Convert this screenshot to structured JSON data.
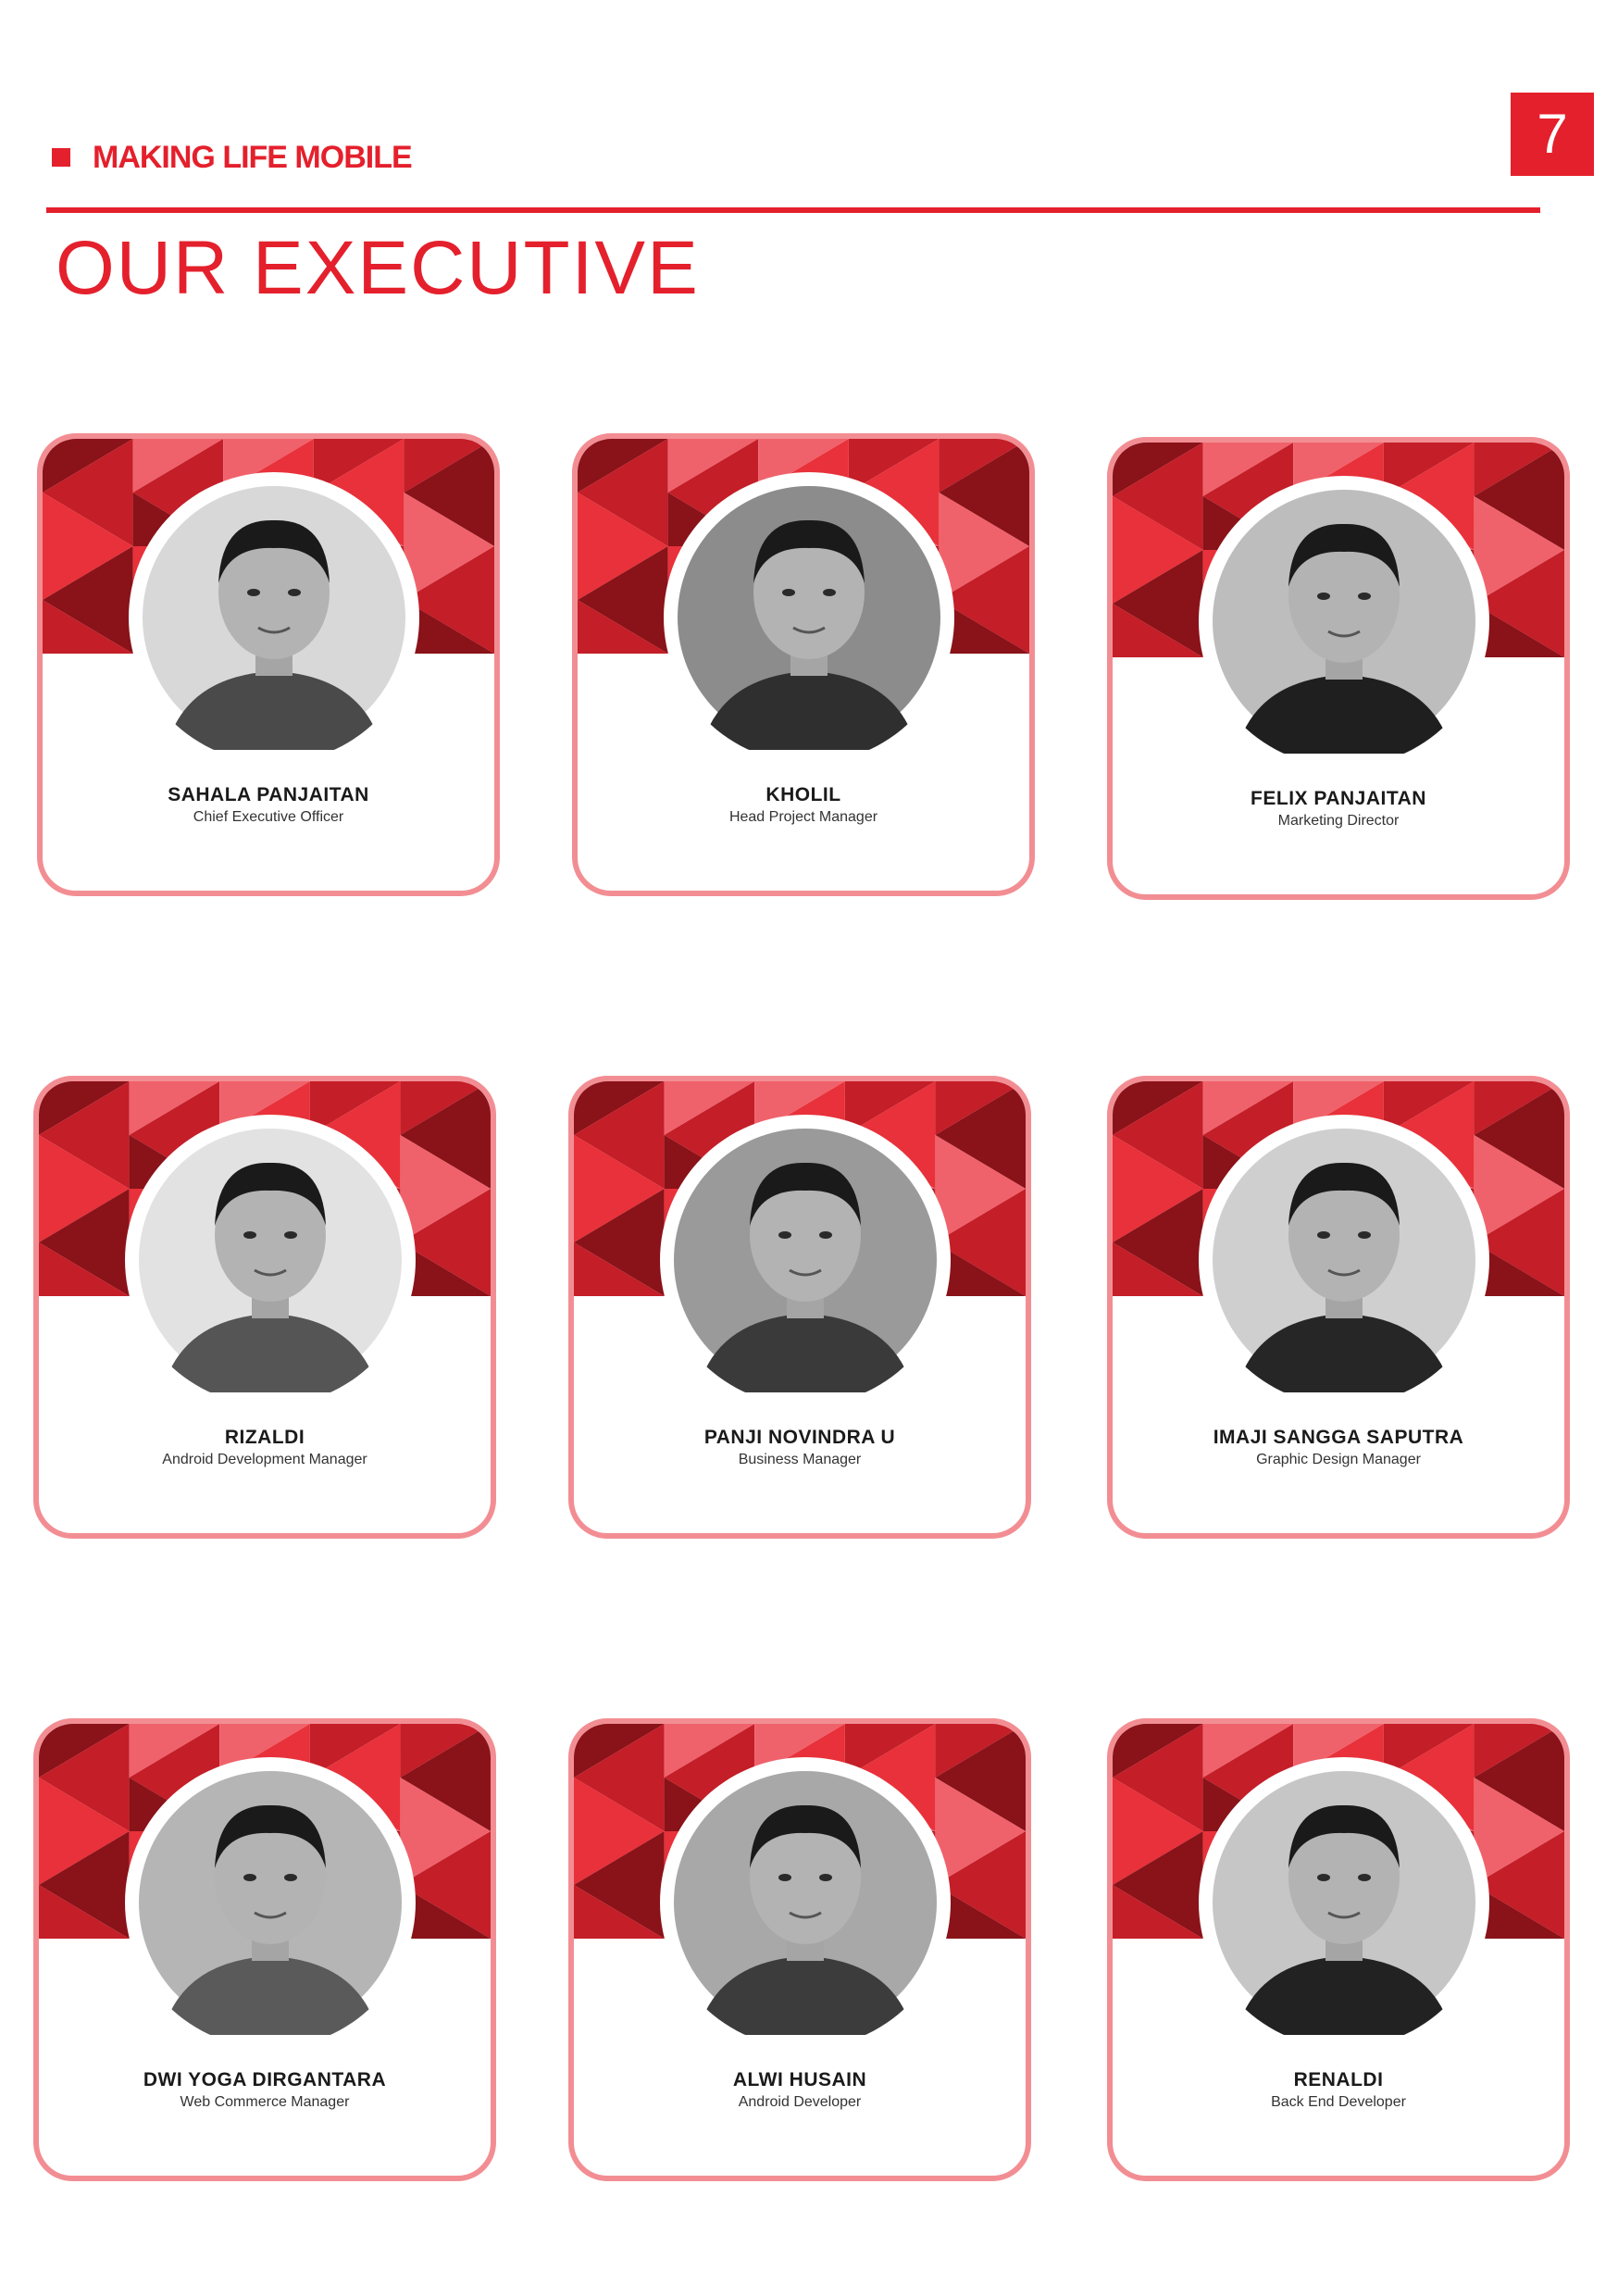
{
  "header": {
    "tagline": "MAKING LIFE MOBILE",
    "page_number": "7",
    "title": "OUR EXECUTIVE"
  },
  "colors": {
    "brand_red": "#e4202c",
    "card_border": "#f28e93",
    "pattern_dark": "#8a1219",
    "pattern_mid": "#c41e28",
    "pattern_bright": "#e8313a",
    "pattern_light": "#f0626b"
  },
  "executives": [
    {
      "name": "SAHALA PANJAITAN",
      "role": "Chief Executive Officer"
    },
    {
      "name": "KHOLIL",
      "role": "Head Project Manager"
    },
    {
      "name": "FELIX PANJAITAN",
      "role": "Marketing Director"
    },
    {
      "name": "RIZALDI",
      "role": "Android Development Manager"
    },
    {
      "name": "PANJI NOVINDRA U",
      "role": "Business Manager"
    },
    {
      "name": "IMAJI SANGGA SAPUTRA",
      "role": "Graphic Design Manager"
    },
    {
      "name": "DWI YOGA DIRGANTARA",
      "role": "Web Commerce Manager"
    },
    {
      "name": "ALWI HUSAIN",
      "role": "Android Developer"
    },
    {
      "name": "RENALDI",
      "role": "Back End Developer"
    }
  ]
}
